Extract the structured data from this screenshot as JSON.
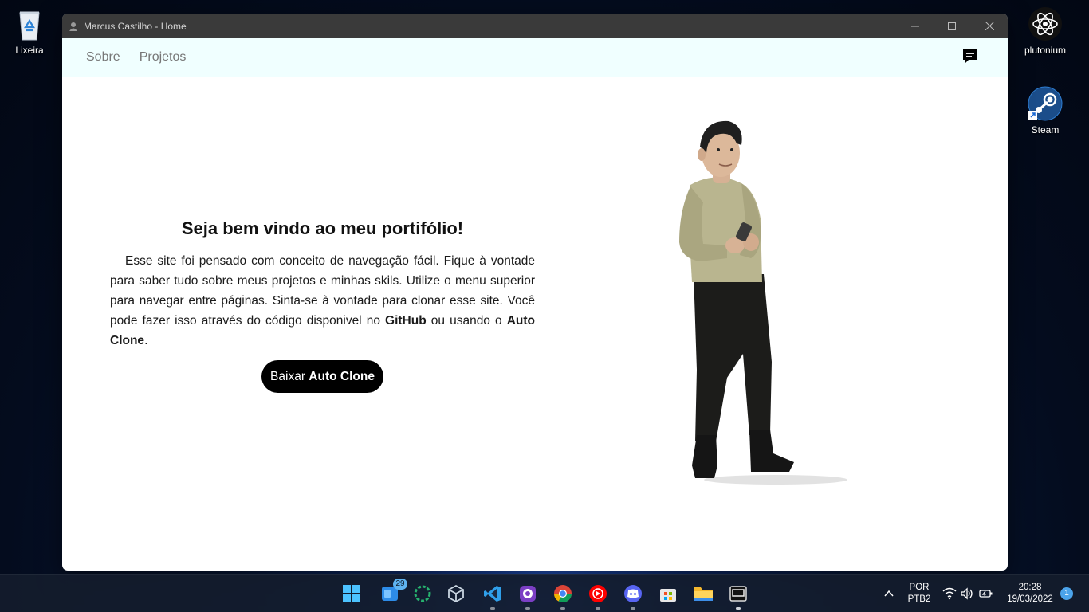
{
  "desktop": {
    "icons": [
      {
        "label": "Lixeira",
        "icon": "recycle-bin-icon"
      },
      {
        "label": "plutonium",
        "icon": "atom-icon"
      },
      {
        "label": "Steam",
        "icon": "steam-icon"
      }
    ]
  },
  "window": {
    "title": "Marcus Castilho - Home",
    "nav": {
      "items": [
        "Sobre",
        "Projetos"
      ],
      "chat_icon": "chat-icon"
    },
    "hero": {
      "title": "Seja bem vindo ao meu portifólio!",
      "p1": "Esse site foi pensado com conceito de navegação fácil. Fique à vontade para saber tudo sobre meus projetos e minhas skils. Utilize o menu superior para navegar entre páginas. Sinta-se à vontade para clonar esse site. Você pode fazer isso através do código disponivel no ",
      "p1_bold": "GitHub",
      "p2": " ou usando o ",
      "p2_bold": "Auto Clone",
      "p3": ".",
      "button_prefix": "Baixar ",
      "button_bold": "Auto Clone"
    }
  },
  "taskbar": {
    "apps": [
      "start",
      "widgets",
      "refresh",
      "virtualbox",
      "vscode",
      "github-desktop",
      "chrome",
      "youtube-music",
      "discord",
      "microsoft-store",
      "file-explorer",
      "terminal"
    ],
    "widgets_badge": "29",
    "lang_line1": "POR",
    "lang_line2": "PTB2",
    "time": "20:28",
    "date": "19/03/2022",
    "notification_count": "1"
  },
  "colors": {
    "nav_bg": "#f0ffff",
    "title_bar": "#3a3a3a",
    "button_bg": "#000000",
    "sweater": "#b9b58f"
  }
}
